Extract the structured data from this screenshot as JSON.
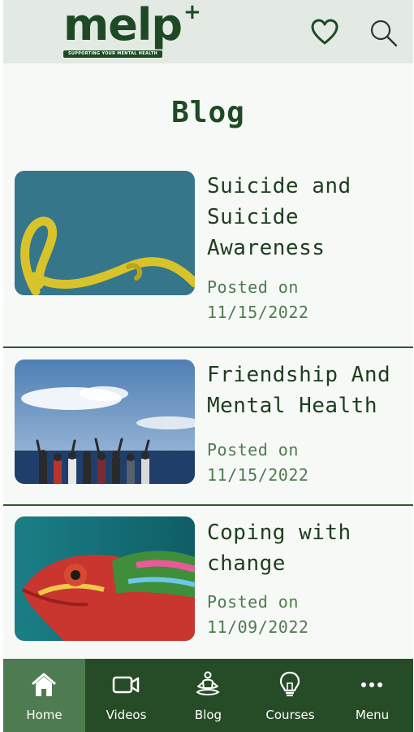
{
  "header": {
    "logo_text": "melp",
    "logo_tagline": "SUPPORTING YOUR MENTAL HEALTH",
    "favorites_icon": "heart-icon",
    "search_icon": "search-icon"
  },
  "page": {
    "title": "Blog"
  },
  "posts": [
    {
      "title": "Suicide and Suicide Awareness",
      "posted_label": "Posted on",
      "date": "11/15/2022",
      "thumbnail": "yellow-ribbon-image"
    },
    {
      "title": "Friendship And Mental Health",
      "posted_label": "Posted on",
      "date": "11/15/2022",
      "thumbnail": "friends-by-the-sea-image"
    },
    {
      "title": "Coping with change",
      "posted_label": "Posted on",
      "date": "11/09/2022",
      "thumbnail": "chameleon-image"
    }
  ],
  "nav": {
    "items": [
      {
        "label": "Home",
        "icon": "home-icon",
        "active": true
      },
      {
        "label": "Videos",
        "icon": "video-camera-icon",
        "active": false
      },
      {
        "label": "Blog",
        "icon": "meditation-icon",
        "active": false
      },
      {
        "label": "Courses",
        "icon": "lightbulb-icon",
        "active": false
      },
      {
        "label": "Menu",
        "icon": "more-dots-icon",
        "active": false
      }
    ]
  },
  "colors": {
    "brand_green": "#1d4a25",
    "header_bg": "#e3e9e3",
    "nav_bg": "#264c27",
    "nav_active_bg": "#4e7b50",
    "meta_text": "#4e7b50"
  }
}
